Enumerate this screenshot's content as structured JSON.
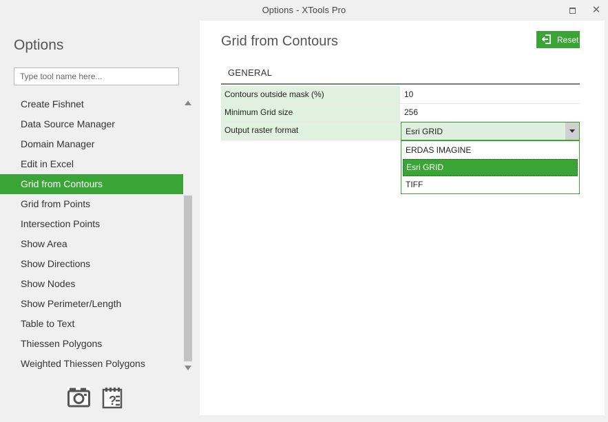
{
  "window": {
    "title_left": "Options",
    "title_sep": "-",
    "title_right": "XTools Pro"
  },
  "sidebar": {
    "heading": "Options",
    "search_placeholder": "Type tool name here...",
    "items": [
      {
        "label": "Create Fishnet"
      },
      {
        "label": "Data Source Manager"
      },
      {
        "label": "Domain Manager"
      },
      {
        "label": "Edit in Excel"
      },
      {
        "label": "Grid from Contours"
      },
      {
        "label": "Grid from Points"
      },
      {
        "label": "Intersection Points"
      },
      {
        "label": "Show Area"
      },
      {
        "label": "Show Directions"
      },
      {
        "label": "Show Nodes"
      },
      {
        "label": "Show Perimeter/Length"
      },
      {
        "label": "Table to Text"
      },
      {
        "label": "Thiessen Polygons"
      },
      {
        "label": "Weighted Thiessen Polygons"
      }
    ],
    "selected_index": 4
  },
  "content": {
    "title": "Grid from Contours",
    "reset_label": "Reset",
    "section": "GENERAL",
    "properties": {
      "contours_mask": {
        "label": "Contours outside mask (%)",
        "value": "10"
      },
      "min_grid": {
        "label": "Minimum Grid size",
        "value": "256"
      },
      "raster_format": {
        "label": "Output raster format",
        "value": "Esri GRID"
      }
    },
    "dropdown_options": [
      "ERDAS IMAGINE",
      "Esri GRID",
      "TIFF"
    ],
    "dropdown_selected_index": 1
  },
  "colors": {
    "accent": "#3aa536",
    "label_bg": "#e1f1df"
  }
}
